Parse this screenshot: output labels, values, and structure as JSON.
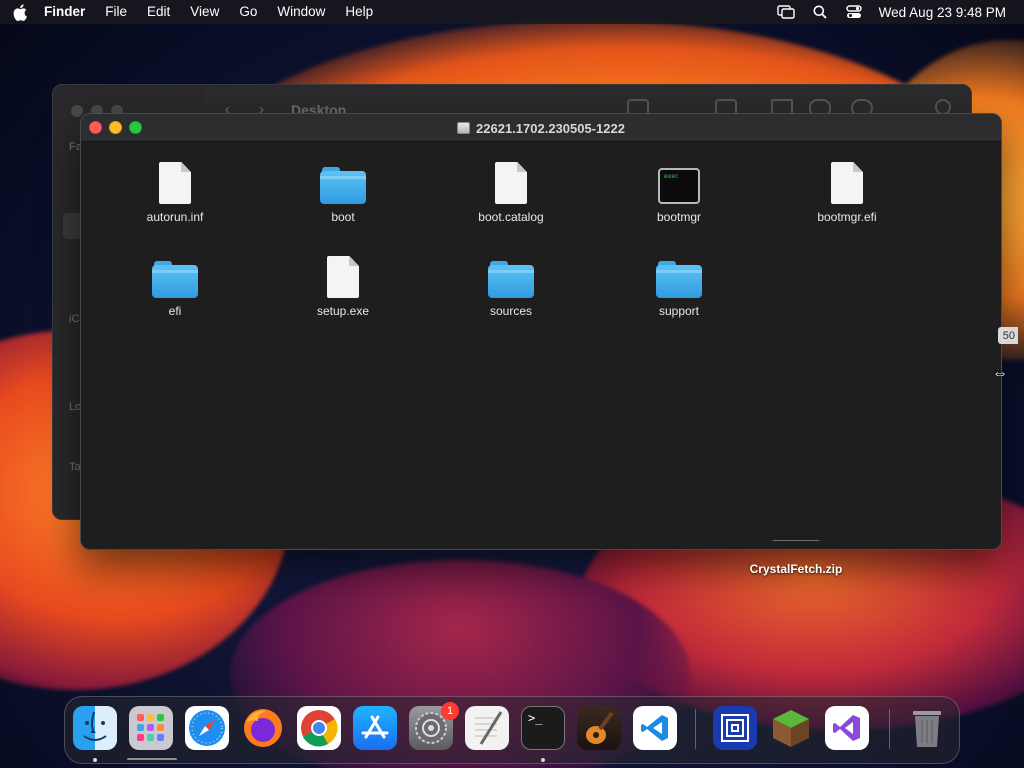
{
  "menubar": {
    "app": "Finder",
    "menus": [
      "File",
      "Edit",
      "View",
      "Go",
      "Window",
      "Help"
    ],
    "clock": "Wed Aug 23  9:48 PM"
  },
  "back_window": {
    "title": "Desktop",
    "sidebar_labels": [
      "Fa",
      "iC",
      "Lo",
      "Ta"
    ]
  },
  "window": {
    "title": "22621.1702.230505-1222",
    "items": [
      {
        "name": "autorun.inf",
        "kind": "document"
      },
      {
        "name": "boot",
        "kind": "folder"
      },
      {
        "name": "boot.catalog",
        "kind": "document"
      },
      {
        "name": "bootmgr",
        "kind": "exec"
      },
      {
        "name": "bootmgr.efi",
        "kind": "document"
      },
      {
        "name": "efi",
        "kind": "folder"
      },
      {
        "name": "setup.exe",
        "kind": "document"
      },
      {
        "name": "sources",
        "kind": "folder"
      },
      {
        "name": "support",
        "kind": "folder"
      }
    ],
    "exec_label": "exec"
  },
  "desktop": {
    "file": "CrystalFetch.zip",
    "partial_badge": "50"
  },
  "dock": {
    "apps": [
      "Finder",
      "Launchpad",
      "Safari",
      "Firefox",
      "Chrome",
      "App Store",
      "System Settings",
      "TextEdit",
      "Terminal",
      "GarageBand",
      "Visual Studio Code",
      "UTM",
      "Minecraft",
      "Visual Studio",
      "Trash"
    ],
    "settings_badge": "1",
    "terminal_prompt": ">_"
  }
}
